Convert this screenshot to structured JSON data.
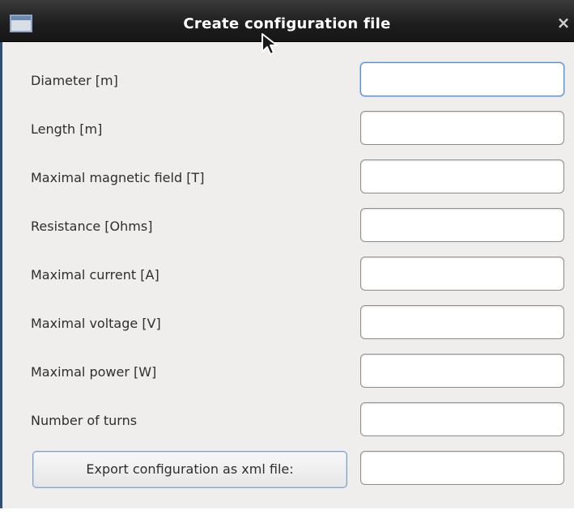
{
  "window": {
    "title": "Create configuration file",
    "close_glyph": "×",
    "icon": "window-app-icon"
  },
  "form": {
    "fields": [
      {
        "label": "Diameter [m]",
        "value": "",
        "focused": true
      },
      {
        "label": "Length [m]",
        "value": ""
      },
      {
        "label": "Maximal magnetic field [T]",
        "value": ""
      },
      {
        "label": "Resistance [Ohms]",
        "value": ""
      },
      {
        "label": "Maximal current [A]",
        "value": ""
      },
      {
        "label": "Maximal voltage [V]",
        "value": ""
      },
      {
        "label": "Maximal power [W]",
        "value": ""
      },
      {
        "label": "Number of turns",
        "value": ""
      }
    ],
    "export_button_label": "Export configuration as xml file:",
    "export_path_value": ""
  },
  "colors": {
    "titlebar": "#1d1d1d",
    "window_bg": "#efeeed",
    "focus_border": "#5d8fc9",
    "button_border": "#7fa1c9"
  }
}
